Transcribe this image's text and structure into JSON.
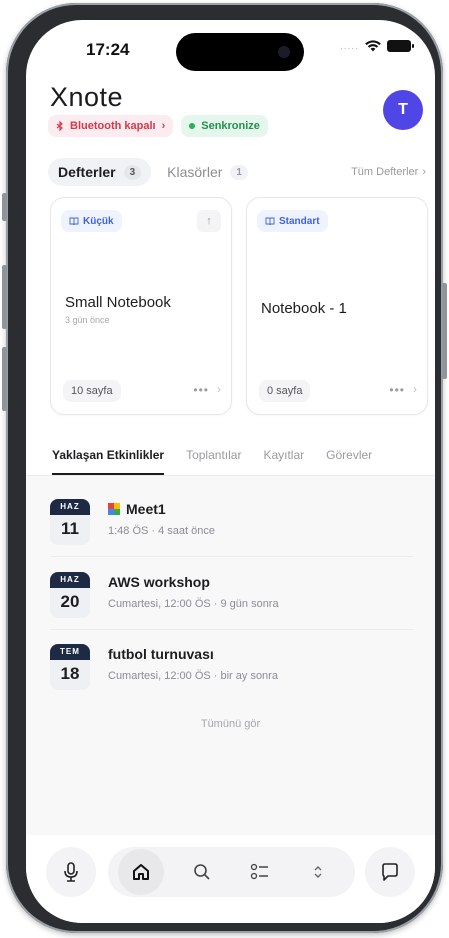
{
  "status_bar": {
    "time": "17:24",
    "signal_dots": "....."
  },
  "app": {
    "logo": "Xnote",
    "avatar_initial": "T"
  },
  "chips": {
    "bluetooth": "Bluetooth kapalı",
    "bluetooth_chevron": "›",
    "sync": "Senkronize"
  },
  "notebook_tabs": {
    "notebooks_label": "Defterler",
    "notebooks_count": "3",
    "folders_label": "Klasörler",
    "folders_count": "1",
    "all_link": "Tüm Defterler",
    "all_chevron": "›"
  },
  "cards": [
    {
      "tag": "Küçük",
      "title": "Small Notebook",
      "subtitle": "3 gün önce",
      "pages": "10 sayfa",
      "more": "•••",
      "chevron": "›",
      "pin": "↑"
    },
    {
      "tag": "Standart",
      "title": "Notebook - 1",
      "subtitle": "",
      "pages": "0 sayfa",
      "more": "•••",
      "chevron": "›"
    }
  ],
  "event_tabs": [
    "Yaklaşan Etkinlikler",
    "Toplantılar",
    "Kayıtlar",
    "Görevler"
  ],
  "events": [
    {
      "month": "HAZ",
      "day": "11",
      "title": "Meet1",
      "meta": "1:48 ÖS · 4 saat önce",
      "icon": "google-meet-icon"
    },
    {
      "month": "HAZ",
      "day": "20",
      "title": "AWS workshop",
      "meta": "Cumartesi, 12:00 ÖS · 9 gün sonra"
    },
    {
      "month": "TEM",
      "day": "18",
      "title": "futbol turnuvası",
      "meta": "Cumartesi, 12:00 ÖS · bir ay sonra"
    }
  ],
  "see_all": "Tümünü gör",
  "bottom_nav": {
    "left": "microphone-icon",
    "items": [
      "home-icon",
      "search-icon",
      "task-list-icon",
      "expand-icon"
    ],
    "right": "chat-icon"
  },
  "colors": {
    "accent": "#4f46e5",
    "tag_blue": "#3f63d8",
    "danger": "#d33a4a",
    "success": "#23914d",
    "date_header": "#1e2a44"
  }
}
